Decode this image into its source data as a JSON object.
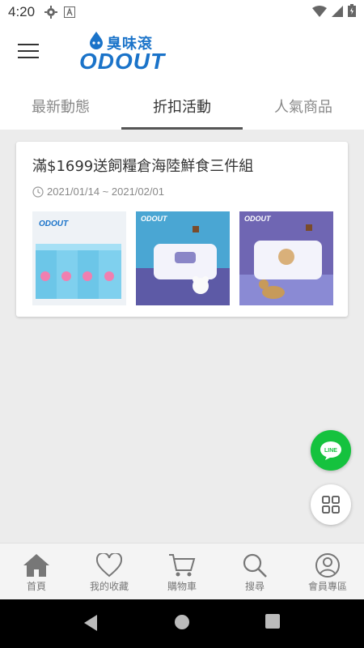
{
  "status_bar": {
    "time": "4:20"
  },
  "header": {
    "menu_icon": "hamburger-menu-icon",
    "logo_cn": "臭味滾",
    "logo_en": "ODOUT"
  },
  "tabs": [
    {
      "label": "最新動態",
      "active": false
    },
    {
      "label": "折扣活動",
      "active": true
    },
    {
      "label": "人氣商品",
      "active": false
    }
  ],
  "promotion": {
    "title": "滿$1699送飼糧倉海陸鮮食三件組",
    "date_range": "2021/01/14 ~ 2021/02/01",
    "images": [
      "product-boxes-image",
      "wet-wipes-cat-image",
      "wet-wipes-dog-image"
    ]
  },
  "fabs": {
    "line_label": "LINE",
    "grid_icon": "grid-menu-icon"
  },
  "bottom_nav": [
    {
      "label": "首頁",
      "icon": "home-icon"
    },
    {
      "label": "我的收藏",
      "icon": "heart-icon"
    },
    {
      "label": "購物車",
      "icon": "cart-icon"
    },
    {
      "label": "搜尋",
      "icon": "search-icon"
    },
    {
      "label": "會員專區",
      "icon": "user-icon"
    }
  ],
  "colors": {
    "brand": "#1a73c9",
    "line_green": "#15c23e",
    "background": "#ececec"
  }
}
